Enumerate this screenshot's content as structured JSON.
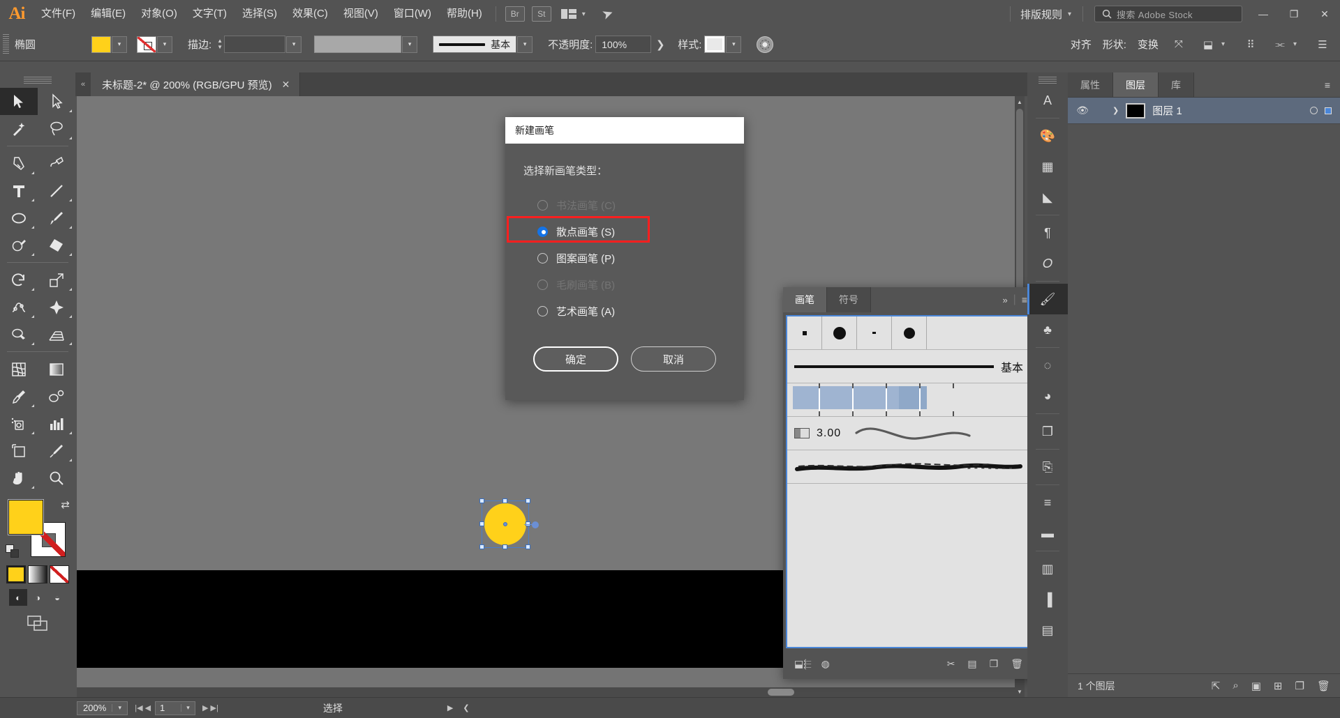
{
  "app": {
    "logo": "Ai",
    "menus": [
      {
        "label": "文件(F)"
      },
      {
        "label": "编辑(E)"
      },
      {
        "label": "对象(O)"
      },
      {
        "label": "文字(T)"
      },
      {
        "label": "选择(S)"
      },
      {
        "label": "效果(C)"
      },
      {
        "label": "视图(V)"
      },
      {
        "label": "窗口(W)"
      },
      {
        "label": "帮助(H)"
      }
    ],
    "bridge_label": "Br",
    "stock_label": "St",
    "typeset_label": "排版规则",
    "search_placeholder": "搜索 Adobe Stock",
    "window_controls": {
      "minimize": "—",
      "restore": "❐",
      "close": "✕"
    }
  },
  "options_bar": {
    "tool_name": "椭圆",
    "fill_color": "#FFD11A",
    "stroke_color": "none",
    "stroke_label": "描边:",
    "stroke_weight": "",
    "profile_value": "",
    "brush_label": "基本",
    "opacity_label": "不透明度:",
    "opacity_value": "100%",
    "style_label": "样式:",
    "align_label": "对齐",
    "shape_label": "形状:",
    "transform_label": "变换"
  },
  "toolbar": {
    "tools": [
      {
        "name": "selection-tool",
        "active": true
      },
      {
        "name": "direct-selection-tool",
        "active": false
      },
      {
        "name": "magic-wand-tool",
        "active": false
      },
      {
        "name": "lasso-tool",
        "active": false
      },
      {
        "name": "pen-tool",
        "active": false
      },
      {
        "name": "curvature-tool",
        "active": false
      },
      {
        "name": "type-tool",
        "active": false
      },
      {
        "name": "line-segment-tool",
        "active": false
      },
      {
        "name": "ellipse-tool",
        "active": false
      },
      {
        "name": "paintbrush-tool",
        "active": false
      },
      {
        "name": "shaper-tool",
        "active": false
      },
      {
        "name": "eraser-tool",
        "active": false
      },
      {
        "name": "rotate-tool",
        "active": false
      },
      {
        "name": "scale-tool",
        "active": false
      },
      {
        "name": "width-tool",
        "active": false
      },
      {
        "name": "free-transform-tool",
        "active": false
      },
      {
        "name": "shape-builder-tool",
        "active": false
      },
      {
        "name": "perspective-grid-tool",
        "active": false
      },
      {
        "name": "mesh-tool",
        "active": false
      },
      {
        "name": "gradient-tool",
        "active": false
      },
      {
        "name": "eyedropper-tool",
        "active": false
      },
      {
        "name": "blend-tool",
        "active": false
      },
      {
        "name": "symbol-sprayer-tool",
        "active": false
      },
      {
        "name": "column-graph-tool",
        "active": false
      },
      {
        "name": "artboard-tool",
        "active": false
      },
      {
        "name": "slice-tool",
        "active": false
      },
      {
        "name": "hand-tool",
        "active": false
      },
      {
        "name": "zoom-tool",
        "active": false
      }
    ],
    "fill_color": "#FFD11A",
    "stroke_color": "#FFFFFF",
    "stroke_is_none": true
  },
  "document_tab": {
    "title": "未标题-2* @ 200% (RGB/GPU 预览)",
    "close_glyph": "✕"
  },
  "dialog": {
    "title": "新建画笔",
    "prompt": "选择新画笔类型：",
    "options": [
      {
        "label": "书法画笔 (C)",
        "selected": false,
        "disabled": true
      },
      {
        "label": "散点画笔 (S)",
        "selected": true,
        "disabled": false,
        "highlighted": true
      },
      {
        "label": "图案画笔 (P)",
        "selected": false,
        "disabled": false
      },
      {
        "label": "毛刷画笔 (B)",
        "selected": false,
        "disabled": true
      },
      {
        "label": "艺术画笔 (A)",
        "selected": false,
        "disabled": false
      }
    ],
    "ok_label": "确定",
    "cancel_label": "取消",
    "highlight_color": "#FF1F1F"
  },
  "brushes_panel": {
    "tabs": [
      {
        "label": "画笔",
        "active": true
      },
      {
        "label": "符号",
        "active": false
      }
    ],
    "collapse_glyph": "»",
    "menu_glyph": "≡",
    "swatch_row": [
      {
        "name": "brush-dot-xs"
      },
      {
        "name": "brush-dot-lg"
      },
      {
        "name": "brush-dash-xs"
      },
      {
        "name": "brush-dot-md"
      }
    ],
    "rows": [
      {
        "type": "basic",
        "label": "基本"
      },
      {
        "type": "pattern",
        "label": ""
      },
      {
        "type": "art",
        "label": "3.00"
      },
      {
        "type": "charcoal",
        "label": ""
      }
    ],
    "footer_icons": [
      "brush-libraries-icon",
      "libraries-panel-icon",
      "remove-brush-link-icon",
      "options-icon",
      "new-brush-icon",
      "delete-brush-icon"
    ]
  },
  "right_panel": {
    "tabs": [
      {
        "label": "属性",
        "active": false
      },
      {
        "label": "图层",
        "active": true
      },
      {
        "label": "库",
        "active": false
      }
    ],
    "menu_glyph": "≡",
    "layers": [
      {
        "name": "图层 1",
        "visible": true,
        "selected": true,
        "expand_glyph": "❯"
      }
    ],
    "footer_count": "1 个图层"
  },
  "status_bar": {
    "zoom_value": "200%",
    "page_value": "1",
    "status_text": "选择"
  },
  "canvas": {
    "selected_shape": "yellow-circle",
    "shape_fill": "#FFD11A",
    "guide_circle_color": "#6F9CD8"
  }
}
